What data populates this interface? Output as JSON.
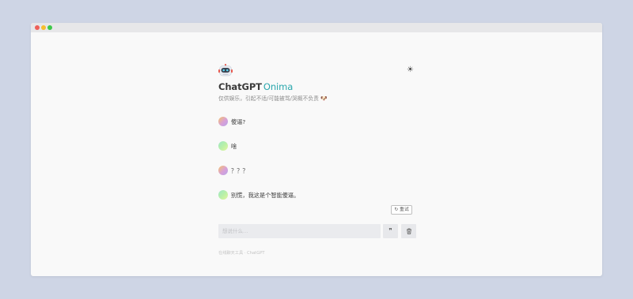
{
  "window": {
    "controls": [
      "close",
      "minimize",
      "maximize"
    ]
  },
  "header": {
    "logo_icon": "robot-icon",
    "title_main": "ChatGPT",
    "title_accent": "Onima",
    "subtitle": "仅供娱乐，引起不适/可能被骂/哭概不负责",
    "subtitle_emoji": "🐶",
    "theme_icon": "☀"
  },
  "messages": [
    {
      "role": "user",
      "text": "傻逼?"
    },
    {
      "role": "bot",
      "text": "啥"
    },
    {
      "role": "user",
      "text": "？？？"
    },
    {
      "role": "bot",
      "text": "别慌，我这是个智能傻逼。"
    }
  ],
  "retry_label": "↻ 重试",
  "input": {
    "value": "",
    "placeholder": "想说什么…"
  },
  "quote_button": "❞",
  "clear_button_icon": "trash-icon",
  "footer": "在线聊天工具 · ChatGPT"
}
